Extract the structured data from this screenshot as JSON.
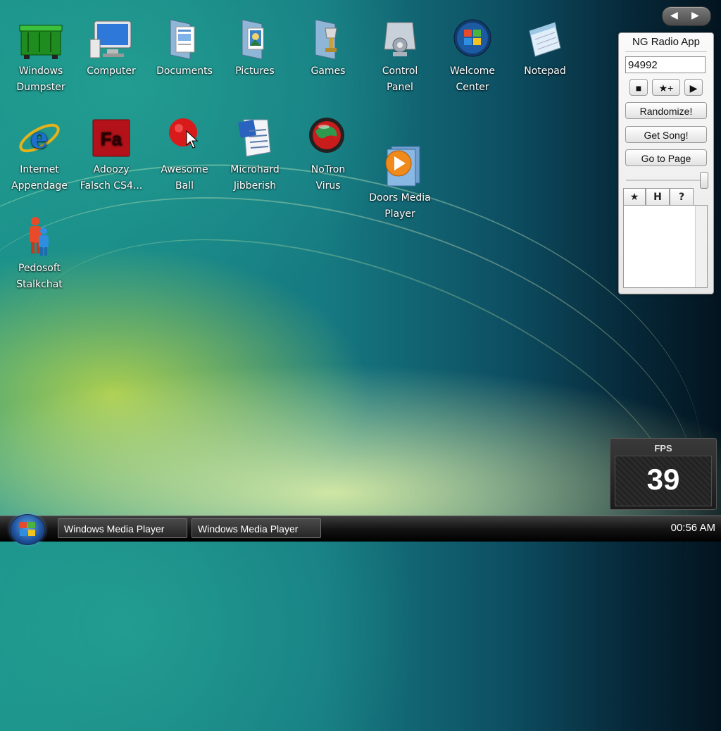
{
  "desktop": {
    "icons": [
      {
        "label": "Windows\nDumpster",
        "icon": "dumpster-icon"
      },
      {
        "label": "Computer",
        "icon": "computer-icon"
      },
      {
        "label": "Documents",
        "icon": "documents-folder-icon"
      },
      {
        "label": "Pictures",
        "icon": "pictures-folder-icon"
      },
      {
        "label": "Games",
        "icon": "games-folder-icon"
      },
      {
        "label": "Control\nPanel",
        "icon": "control-panel-icon"
      },
      {
        "label": "Welcome\nCenter",
        "icon": "windows-logo-icon"
      },
      {
        "label": "Notepad",
        "icon": "notepad-icon"
      },
      {
        "label": "Internet\nAppendage",
        "icon": "internet-explorer-icon"
      },
      {
        "label": "Adoozy\nFalsch CS4...",
        "icon": "flash-icon"
      },
      {
        "label": "Awesome\nBall",
        "icon": "red-ball-icon"
      },
      {
        "label": "Microhard\nJibberish",
        "icon": "word-document-icon"
      },
      {
        "label": "NoTron\nVirus",
        "icon": "globe-virus-icon"
      },
      {
        "label": "Doors Media\nPlayer",
        "icon": "media-player-icon"
      },
      {
        "label": "Pedosoft\nStalkchat",
        "icon": "messenger-people-icon"
      }
    ]
  },
  "gadget": {
    "title": "NG Radio App",
    "input_value": "94992",
    "controls": [
      "■",
      "★+",
      "▶"
    ],
    "buttons": [
      "Randomize!",
      "Get Song!",
      "Go to Page"
    ],
    "tabs": [
      "★",
      "H",
      "?"
    ]
  },
  "fps": {
    "label": "FPS",
    "value": "39"
  },
  "taskbar": {
    "tasks": [
      "Windows Media Player",
      "Windows Media Player"
    ],
    "clock": "00:56 AM"
  },
  "colors": {
    "accent_blue": "#1d6fd6",
    "taskbar": "#141414"
  }
}
